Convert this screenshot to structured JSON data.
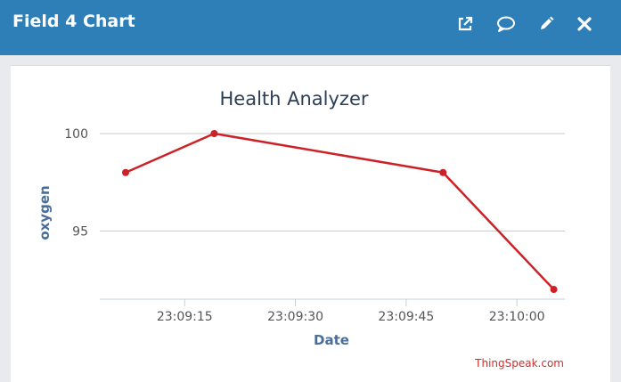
{
  "header": {
    "title": "Field 4 Chart",
    "icons": [
      "external-link-icon",
      "comment-icon",
      "pencil-icon",
      "close-icon"
    ],
    "background": "#2e7fb8"
  },
  "credit": "ThingSpeak.com",
  "chart_data": {
    "type": "line",
    "title": "Health Analyzer",
    "xlabel": "Date",
    "ylabel": "oxygen",
    "x": [
      "23:09:07",
      "23:09:19",
      "23:09:50",
      "23:10:05"
    ],
    "values": [
      98,
      100,
      98,
      92
    ],
    "x_ticks": [
      "23:09:15",
      "23:09:30",
      "23:09:45",
      "23:10:00"
    ],
    "y_ticks": [
      95,
      100
    ],
    "ylim": [
      91.5,
      100
    ],
    "grid": true,
    "color": "#cc2127"
  }
}
